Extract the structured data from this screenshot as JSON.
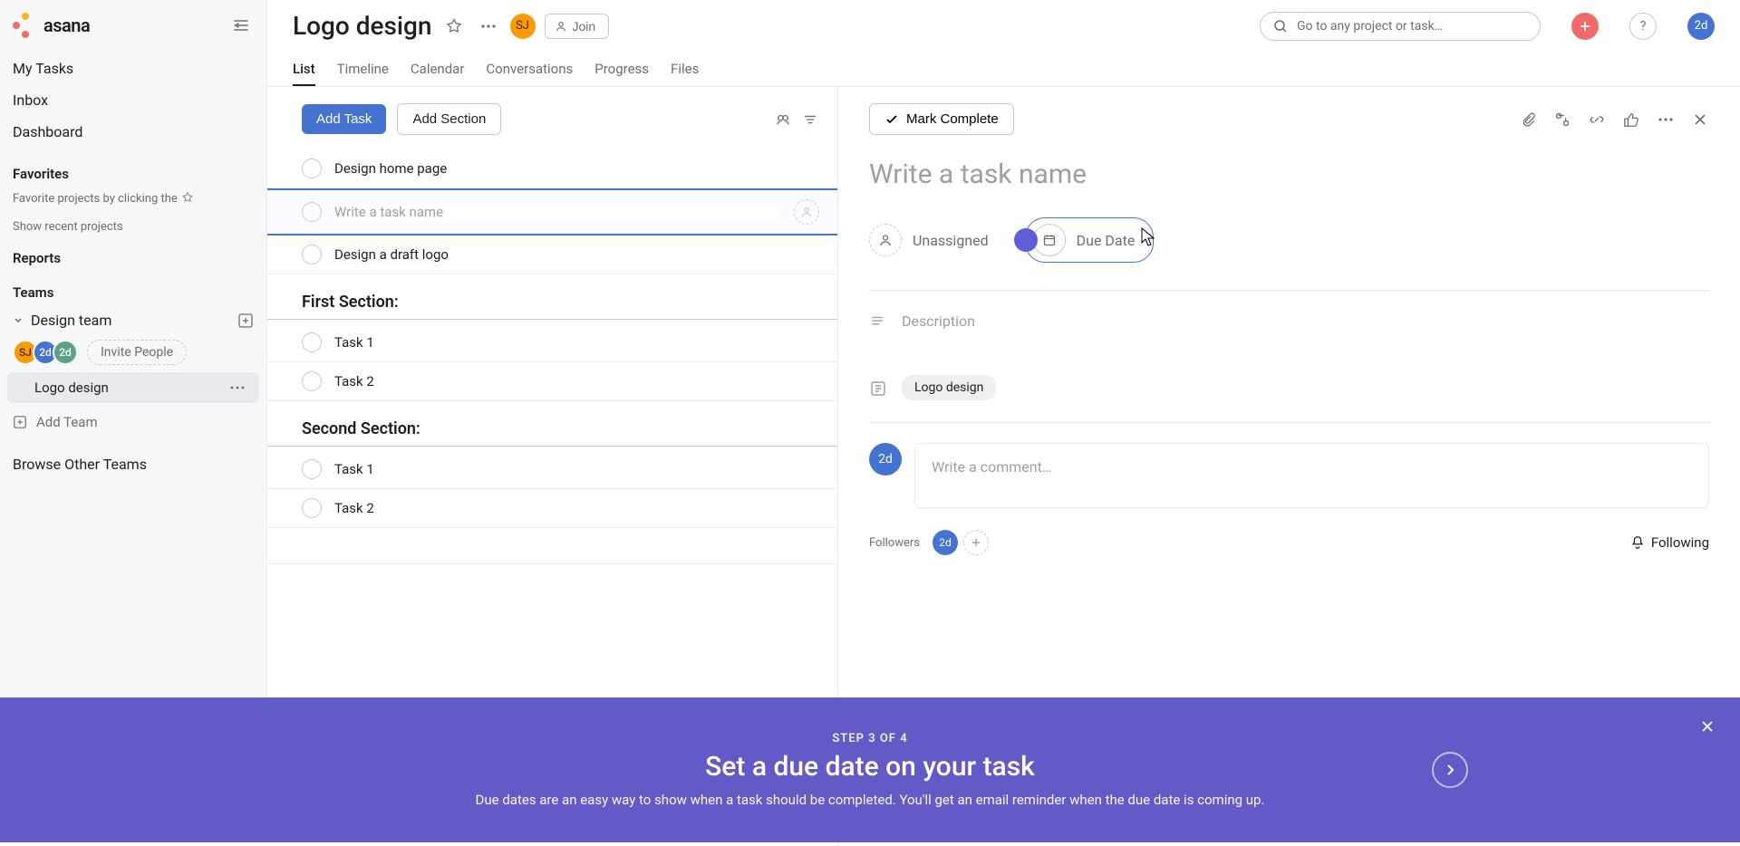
{
  "brand": {
    "name": "asana"
  },
  "nav": {
    "items": [
      {
        "label": "My Tasks"
      },
      {
        "label": "Inbox"
      },
      {
        "label": "Dashboard"
      }
    ]
  },
  "favorites": {
    "heading": "Favorites",
    "hint_prefix": "Favorite projects by clicking the",
    "recent_link": "Show recent projects"
  },
  "reports": {
    "heading": "Reports"
  },
  "teams": {
    "heading": "Teams",
    "team_name": "Design team",
    "invite_label": "Invite People",
    "project": "Logo design",
    "members": [
      {
        "initials": "SJ",
        "cls": "sj"
      },
      {
        "initials": "2d",
        "cls": "blue"
      },
      {
        "initials": "2d",
        "cls": "green"
      }
    ],
    "add_team": "Add Team",
    "browse": "Browse Other Teams"
  },
  "header": {
    "title": "Logo design",
    "join": "Join",
    "search_placeholder": "Go to any project or task…",
    "current_user": "2d",
    "tabs": [
      {
        "label": "List",
        "active": true
      },
      {
        "label": "Timeline"
      },
      {
        "label": "Calendar"
      },
      {
        "label": "Conversations"
      },
      {
        "label": "Progress"
      },
      {
        "label": "Files"
      }
    ]
  },
  "list": {
    "add_task": "Add Task",
    "add_section": "Add Section",
    "new_task_placeholder": "Write a task name",
    "tasks_top": [
      {
        "name": "Design home page"
      }
    ],
    "tasks_top_after": [
      {
        "name": "Design a draft logo"
      }
    ],
    "sections": [
      {
        "title": "First Section:",
        "tasks": [
          {
            "name": "Task 1"
          },
          {
            "name": "Task 2"
          }
        ]
      },
      {
        "title": "Second Section:",
        "tasks": [
          {
            "name": "Task 1"
          },
          {
            "name": "Task 2"
          }
        ]
      }
    ]
  },
  "detail": {
    "mark_complete": "Mark Complete",
    "title_placeholder": "Write a task name",
    "unassigned": "Unassigned",
    "due_date": "Due Date",
    "description": "Description",
    "project_chip": "Logo design",
    "comment_placeholder": "Write a comment…",
    "followers_label": "Followers",
    "following": "Following",
    "current_user": "2d"
  },
  "onboarding": {
    "step": "STEP 3 OF 4",
    "title": "Set a due date on your task",
    "body": "Due dates are an easy way to show when a task should be completed. You'll get an email reminder when the due date is coming up."
  }
}
